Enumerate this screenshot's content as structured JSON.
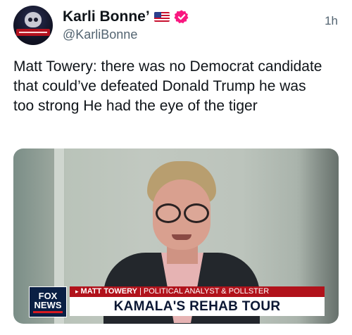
{
  "tweet": {
    "author": {
      "display_name": "Karli Bonne’",
      "handle": "@KarliBonne",
      "flag_icon": "us-flag-icon",
      "verified_icon": "verified-badge-icon",
      "verified_color": "#f91880"
    },
    "time": "1h",
    "text": "Matt Towery: there was no Democrat candidate that could’ve defeated Donald Trump he was too strong He had the eye of the tiger"
  },
  "media": {
    "network_logo_top": "FOX",
    "network_logo_bottom": "NEWS",
    "name_strip": {
      "arrow": "▸",
      "name": "MATT TOWERY",
      "separator": "|",
      "role": "POLITICAL ANALYST & POLLSTER"
    },
    "headline": "KAMALA'S REHAB TOUR",
    "colors": {
      "strip_red": "#b1121b",
      "headline_navy": "#0b1733",
      "logo_navy": "#0a1f44"
    }
  }
}
